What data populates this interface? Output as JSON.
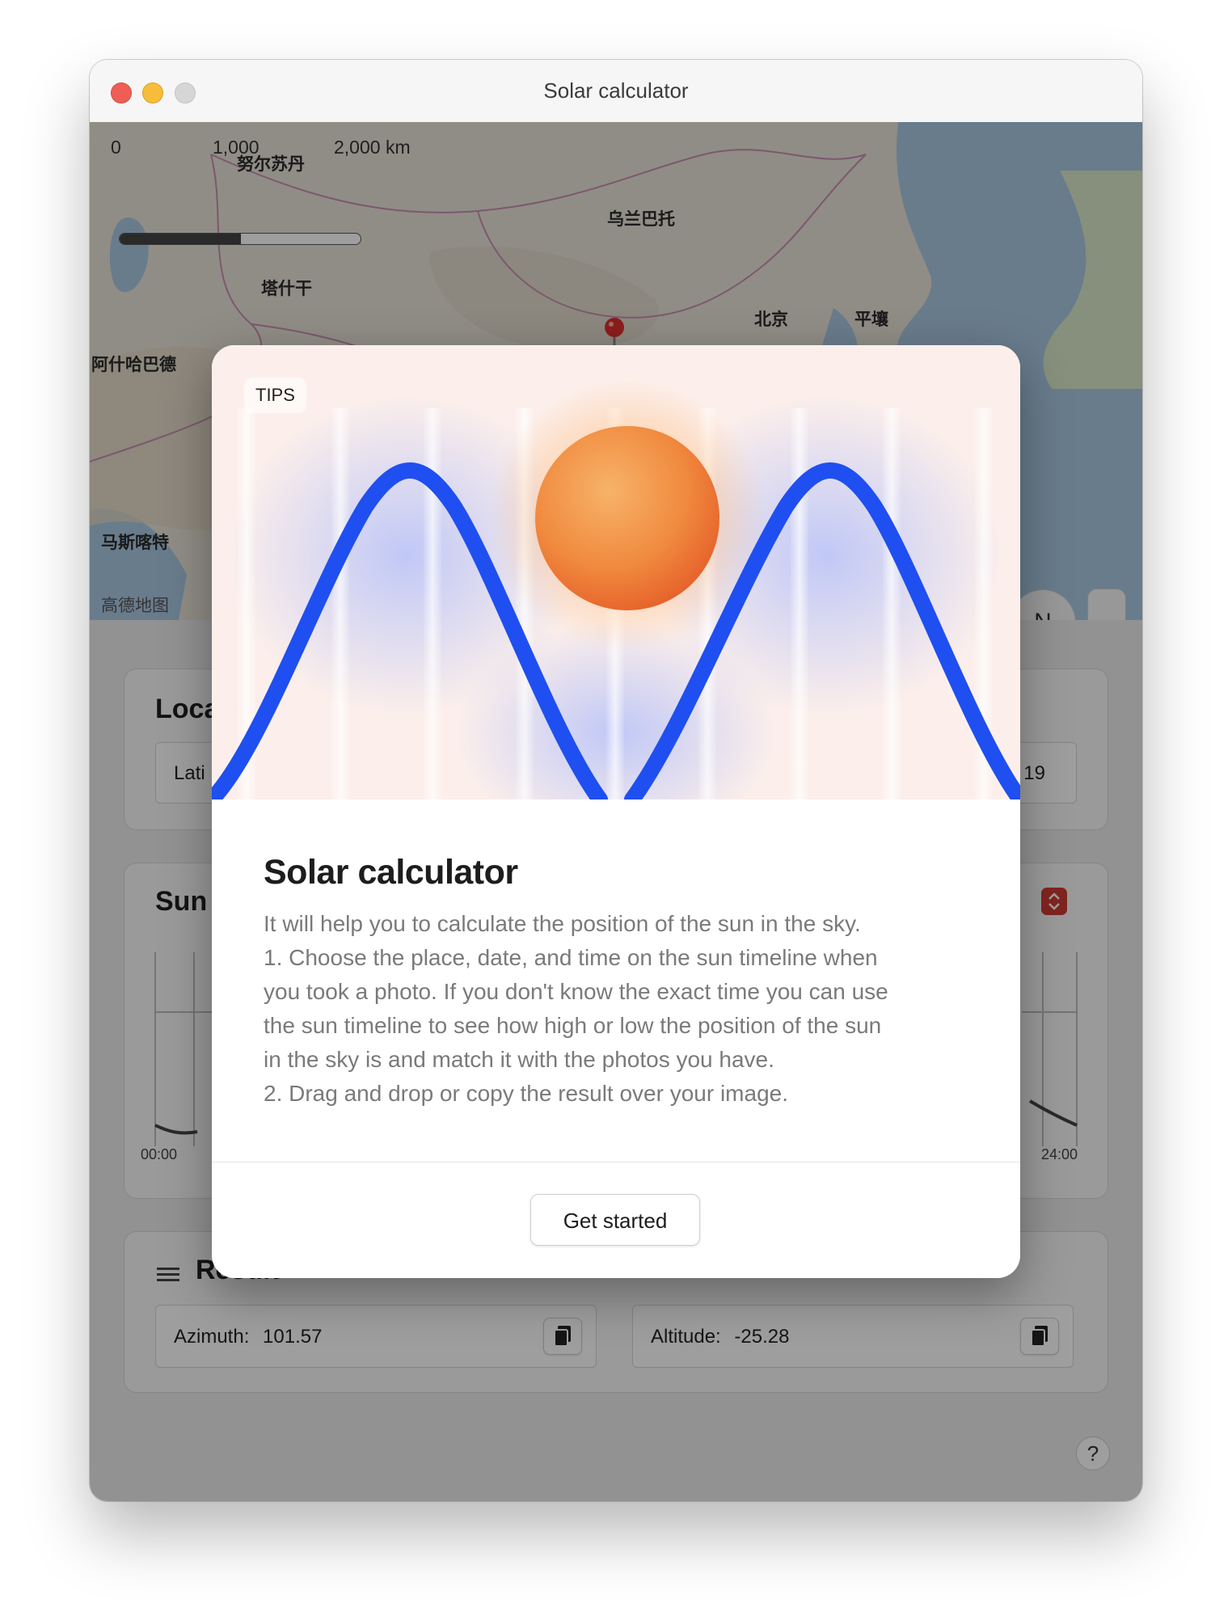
{
  "window": {
    "title": "Solar calculator"
  },
  "map": {
    "scale": {
      "zero": "0",
      "mid": "1,000",
      "end": "2,000 km"
    },
    "places": [
      "努尔苏丹",
      "乌兰巴托",
      "塔什干",
      "北京",
      "平壤",
      "阿什哈巴德",
      "马斯喀特"
    ],
    "watermark": "高德地图",
    "compass": "N"
  },
  "location": {
    "title": "Loca",
    "latitude_label": "Lati",
    "longitude_tail": "19"
  },
  "sun_section": {
    "title": "Sun",
    "time_start": "00:00",
    "time_end": "24:00"
  },
  "result": {
    "title": "Result",
    "azimuth_label": "Azimuth:",
    "azimuth_value": "101.57",
    "altitude_label": "Altitude:",
    "altitude_value": "-25.28"
  },
  "help": "?",
  "dialog": {
    "tag": "TIPS",
    "title": "Solar calculator",
    "lines": [
      "It will help you to calculate the position of the sun in the sky.",
      "1. Choose the place, date, and time on the sun timeline when",
      "you took a photo. If you don't know the exact time you can use",
      "the sun timeline to see how high or low the position of the sun",
      "in the sky is and match it with the photos you have.",
      "2. Drag and drop or copy the result over your image."
    ],
    "button": "Get started"
  },
  "colors": {
    "accent_blue": "#1f4ff0",
    "sun_orange": "#f07a3a",
    "stepper_red": "#d03a33",
    "pin_red": "#e0302c"
  }
}
